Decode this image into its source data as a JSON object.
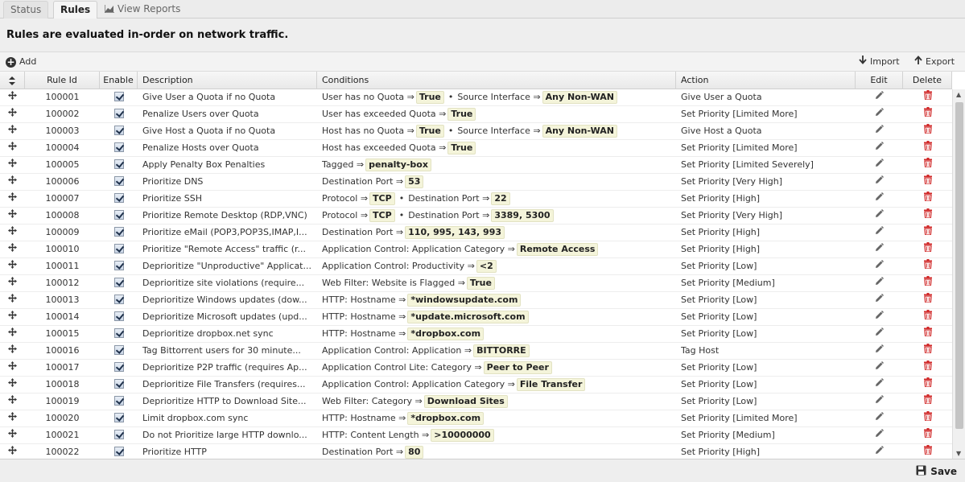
{
  "tabs": [
    {
      "label": "Status",
      "active": false
    },
    {
      "label": "Rules",
      "active": true
    },
    {
      "label": "View Reports",
      "active": false
    }
  ],
  "banner": "Rules are evaluated in-order on network traffic.",
  "toolbar": {
    "add_label": "Add",
    "import_label": "Import",
    "export_label": "Export"
  },
  "columns": {
    "rule_id": "Rule Id",
    "enable": "Enable",
    "description": "Description",
    "conditions": "Conditions",
    "action": "Action",
    "edit": "Edit",
    "delete": "Delete"
  },
  "rules": [
    {
      "id": "100001",
      "enabled": true,
      "description": "Give User a Quota if no Quota",
      "conditions": [
        {
          "label": "User has no Quota ⇒",
          "value": "True"
        },
        {
          "label": "Source Interface ⇒",
          "value": "Any Non-WAN"
        }
      ],
      "action": "Give User a Quota"
    },
    {
      "id": "100002",
      "enabled": true,
      "description": "Penalize Users over Quota",
      "conditions": [
        {
          "label": "User has exceeded Quota ⇒",
          "value": "True"
        }
      ],
      "action": "Set Priority [Limited More]"
    },
    {
      "id": "100003",
      "enabled": true,
      "description": "Give Host a Quota if no Quota",
      "conditions": [
        {
          "label": "Host has no Quota ⇒",
          "value": "True"
        },
        {
          "label": "Source Interface ⇒",
          "value": "Any Non-WAN"
        }
      ],
      "action": "Give Host a Quota"
    },
    {
      "id": "100004",
      "enabled": true,
      "description": "Penalize Hosts over Quota",
      "conditions": [
        {
          "label": "Host has exceeded Quota ⇒",
          "value": "True"
        }
      ],
      "action": "Set Priority [Limited More]"
    },
    {
      "id": "100005",
      "enabled": true,
      "description": "Apply Penalty Box Penalties",
      "conditions": [
        {
          "label": "Tagged ⇒",
          "value": "penalty-box"
        }
      ],
      "action": "Set Priority [Limited Severely]"
    },
    {
      "id": "100006",
      "enabled": true,
      "description": "Prioritize DNS",
      "conditions": [
        {
          "label": "Destination Port ⇒",
          "value": "53"
        }
      ],
      "action": "Set Priority [Very High]"
    },
    {
      "id": "100007",
      "enabled": true,
      "description": "Prioritize SSH",
      "conditions": [
        {
          "label": "Protocol ⇒",
          "value": "TCP"
        },
        {
          "label": "Destination Port ⇒",
          "value": "22"
        }
      ],
      "action": "Set Priority [High]"
    },
    {
      "id": "100008",
      "enabled": true,
      "description": "Prioritize Remote Desktop (RDP,VNC)",
      "conditions": [
        {
          "label": "Protocol ⇒",
          "value": "TCP"
        },
        {
          "label": "Destination Port ⇒",
          "value": "3389, 5300"
        }
      ],
      "action": "Set Priority [Very High]"
    },
    {
      "id": "100009",
      "enabled": true,
      "description": "Prioritize eMail (POP3,POP3S,IMAP,I...",
      "conditions": [
        {
          "label": "Destination Port ⇒",
          "value": "110, 995, 143, 993"
        }
      ],
      "action": "Set Priority [High]"
    },
    {
      "id": "100010",
      "enabled": true,
      "description": "Prioritize \"Remote Access\" traffic (r...",
      "conditions": [
        {
          "label": "Application Control: Application Category ⇒",
          "value": "Remote Access"
        }
      ],
      "action": "Set Priority [High]"
    },
    {
      "id": "100011",
      "enabled": true,
      "description": "Deprioritize \"Unproductive\" Applicat...",
      "conditions": [
        {
          "label": "Application Control: Productivity ⇒",
          "value": "<2"
        }
      ],
      "action": "Set Priority [Low]"
    },
    {
      "id": "100012",
      "enabled": true,
      "description": "Deprioritize site violations (require...",
      "conditions": [
        {
          "label": "Web Filter: Website is Flagged ⇒",
          "value": "True"
        }
      ],
      "action": "Set Priority [Medium]"
    },
    {
      "id": "100013",
      "enabled": true,
      "description": "Deprioritize Windows updates (dow...",
      "conditions": [
        {
          "label": "HTTP: Hostname ⇒",
          "value": "*windowsupdate.com"
        }
      ],
      "action": "Set Priority [Low]"
    },
    {
      "id": "100014",
      "enabled": true,
      "description": "Deprioritize Microsoft updates (upd...",
      "conditions": [
        {
          "label": "HTTP: Hostname ⇒",
          "value": "*update.microsoft.com"
        }
      ],
      "action": "Set Priority [Low]"
    },
    {
      "id": "100015",
      "enabled": true,
      "description": "Deprioritize dropbox.net sync",
      "conditions": [
        {
          "label": "HTTP: Hostname ⇒",
          "value": "*dropbox.com"
        }
      ],
      "action": "Set Priority [Low]"
    },
    {
      "id": "100016",
      "enabled": true,
      "description": "Tag Bittorrent users for 30 minute...",
      "conditions": [
        {
          "label": "Application Control: Application ⇒",
          "value": "BITTORRE"
        }
      ],
      "action": "Tag Host"
    },
    {
      "id": "100017",
      "enabled": true,
      "description": "Deprioritize P2P traffic (requires Ap...",
      "conditions": [
        {
          "label": "Application Control Lite: Category ⇒",
          "value": "Peer to Peer"
        }
      ],
      "action": "Set Priority [Low]"
    },
    {
      "id": "100018",
      "enabled": true,
      "description": "Deprioritize File Transfers (requires...",
      "conditions": [
        {
          "label": "Application Control: Application Category ⇒",
          "value": "File Transfer"
        }
      ],
      "action": "Set Priority [Low]"
    },
    {
      "id": "100019",
      "enabled": true,
      "description": "Deprioritize HTTP to Download Site...",
      "conditions": [
        {
          "label": "Web Filter: Category ⇒",
          "value": "Download Sites"
        }
      ],
      "action": "Set Priority [Low]"
    },
    {
      "id": "100020",
      "enabled": true,
      "description": "Limit dropbox.com sync",
      "conditions": [
        {
          "label": "HTTP: Hostname ⇒",
          "value": "*dropbox.com"
        }
      ],
      "action": "Set Priority [Limited More]"
    },
    {
      "id": "100021",
      "enabled": true,
      "description": "Do not Prioritize large HTTP downlo...",
      "conditions": [
        {
          "label": "HTTP: Content Length ⇒",
          "value": ">10000000"
        }
      ],
      "action": "Set Priority [Medium]"
    },
    {
      "id": "100022",
      "enabled": true,
      "description": "Prioritize HTTP",
      "conditions": [
        {
          "label": "Destination Port ⇒",
          "value": "80"
        }
      ],
      "action": "Set Priority [High]"
    }
  ],
  "footer": {
    "save_label": "Save"
  }
}
